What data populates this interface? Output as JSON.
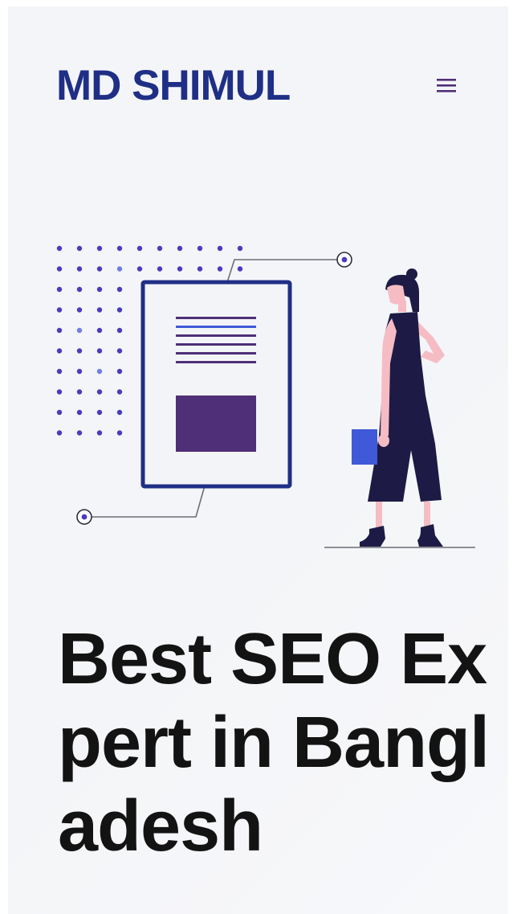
{
  "header": {
    "logo_text": "MD SHIMUL",
    "menu_icon": "hamburger-icon"
  },
  "hero": {
    "illustration": "woman-presenting-document-illustration",
    "title": "Best SEO Expert in Bangladesh"
  },
  "colors": {
    "brand": "#1f2f86",
    "accent_purple": "#4f2f78",
    "accent_blue": "#4059d8",
    "figure_dark": "#1d1b45",
    "skin": "#f6bcc4",
    "dot_primary": "#4b3bbf",
    "page_bg": "#f4f5f8",
    "title_text": "#131313"
  }
}
